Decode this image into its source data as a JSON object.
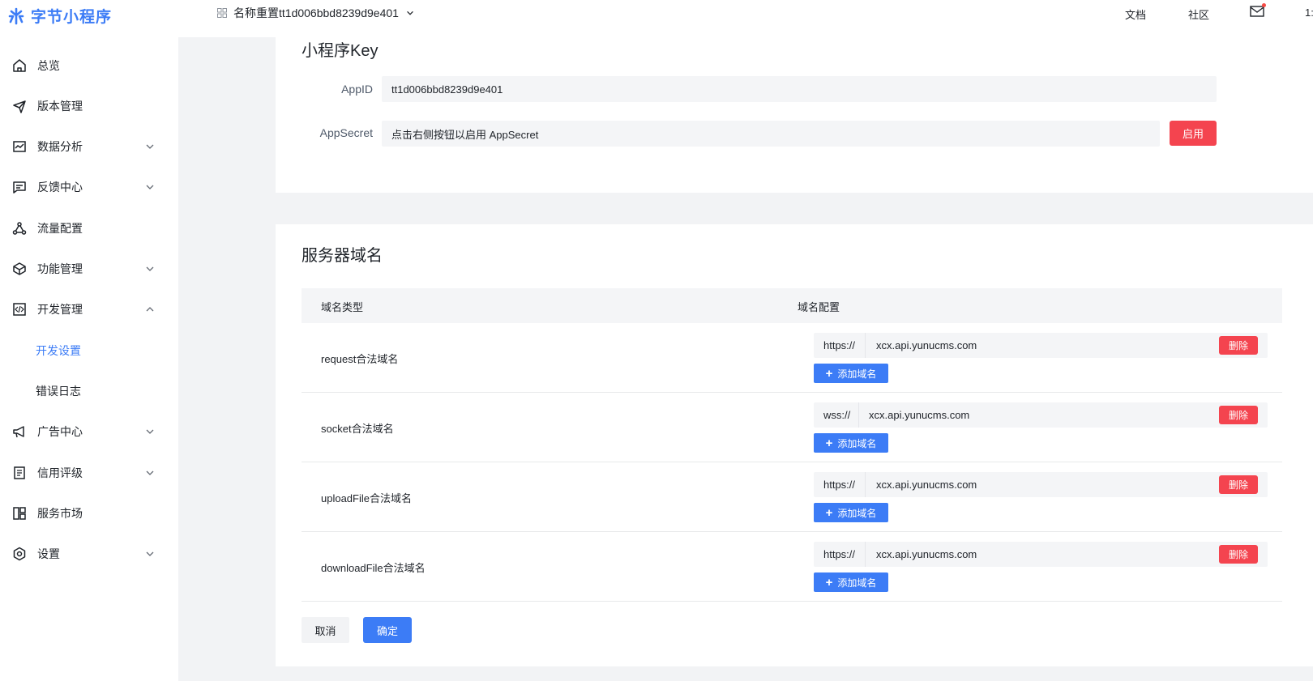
{
  "brand": {
    "name": "字节小程序",
    "color": "#3c7cf6"
  },
  "topbar": {
    "app_name": "名称重置tt1d006bbd8239d9e401",
    "doc_link": "文档",
    "community_link": "社区",
    "partial_text": "1:"
  },
  "sidebar": {
    "items": [
      {
        "label": "总览",
        "icon": "home-icon"
      },
      {
        "label": "版本管理",
        "icon": "send-icon"
      },
      {
        "label": "数据分析",
        "icon": "chart-line-icon",
        "expandable": true
      },
      {
        "label": "反馈中心",
        "icon": "message-icon",
        "expandable": true
      },
      {
        "label": "流量配置",
        "icon": "flow-icon"
      },
      {
        "label": "功能管理",
        "icon": "cube-icon",
        "expandable": true
      },
      {
        "label": "开发管理",
        "icon": "code-icon",
        "expandable": true,
        "expanded": true
      },
      {
        "label": "开发设置",
        "sub": true,
        "active": true
      },
      {
        "label": "错误日志",
        "sub": true
      },
      {
        "label": "广告中心",
        "icon": "megaphone-icon",
        "expandable": true
      },
      {
        "label": "信用评级",
        "icon": "document-icon",
        "expandable": true
      },
      {
        "label": "服务市场",
        "icon": "layout-icon"
      },
      {
        "label": "设置",
        "icon": "gear-icon",
        "expandable": true
      }
    ]
  },
  "key_section": {
    "title": "小程序Key",
    "appid_label": "AppID",
    "appid_value": "tt1d006bbd8239d9e401",
    "secret_label": "AppSecret",
    "secret_value": "点击右侧按钮以启用 AppSecret",
    "enable_button": "启用"
  },
  "server_section": {
    "title": "服务器域名",
    "col_type": "域名类型",
    "col_config": "域名配置",
    "rows": [
      {
        "type": "request合法域名",
        "protocol": "https://",
        "domain": "xcx.api.yunucms.com"
      },
      {
        "type": "socket合法域名",
        "protocol": "wss://",
        "domain": "xcx.api.yunucms.com"
      },
      {
        "type": "uploadFile合法域名",
        "protocol": "https://",
        "domain": "xcx.api.yunucms.com"
      },
      {
        "type": "downloadFile合法域名",
        "protocol": "https://",
        "domain": "xcx.api.yunucms.com"
      }
    ],
    "delete_label": "删除",
    "add_label": "添加域名",
    "cancel_button": "取消",
    "confirm_button": "确定"
  }
}
